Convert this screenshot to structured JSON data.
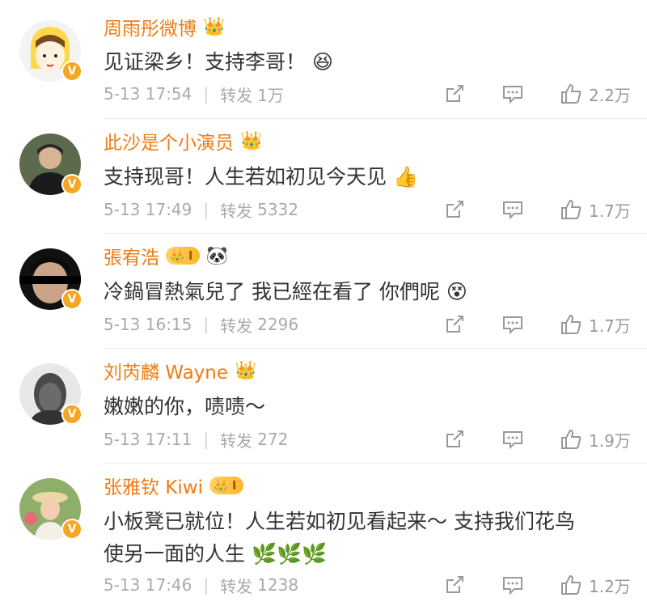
{
  "comments": [
    {
      "user": "周雨彤微博",
      "text": "见证梁乡！支持李哥！",
      "emoji": "😆",
      "date": "5-13 17:54",
      "repost_label": "转发",
      "repost_count": "1万",
      "likes": "2.2万",
      "crown": "👑"
    },
    {
      "user": "此沙是个小演员",
      "text": "支持现哥！人生若如初见今天见",
      "emoji": "👍",
      "date": "5-13 17:49",
      "repost_label": "转发",
      "repost_count": "5332",
      "likes": "1.7万",
      "crown": "👑"
    },
    {
      "user": "張宥浩",
      "text": "冷鍋冒熱氣兒了 我已經在看了 你們呢",
      "emoji": "😵",
      "date": "5-13 16:15",
      "repost_label": "转发",
      "repost_count": "2296",
      "likes": "1.7万",
      "level": "I",
      "extra_emoji": "🐼"
    },
    {
      "user": "刘芮麟 Wayne",
      "text": "嫩嫩的你，啧啧～",
      "date": "5-13 17:11",
      "repost_label": "转发",
      "repost_count": "272",
      "likes": "1.9万",
      "crown": "👑"
    },
    {
      "user": "张雅钦 Kiwi",
      "text_line1": "小板凳已就位！人生若如初见看起来～ 支持我们花鸟",
      "text_line2": "使另一面的人生",
      "emoji": "🌿🌿🌿",
      "date": "5-13 17:46",
      "repost_label": "转发",
      "repost_count": "1238",
      "likes": "1.2万",
      "level": "I"
    }
  ],
  "badge_letter": "V",
  "colors": {
    "username": "#f07c13",
    "meta": "#aaaaaa",
    "badge": "#f5a623"
  }
}
